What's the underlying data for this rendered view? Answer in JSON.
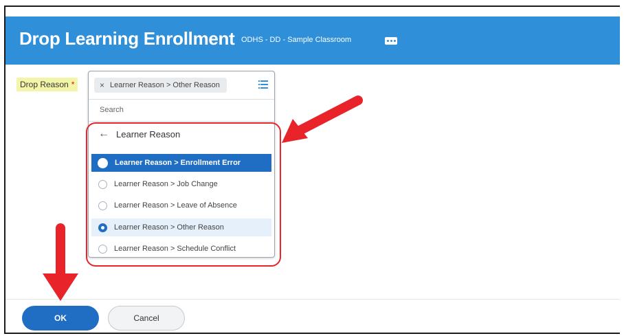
{
  "header": {
    "title": "Drop Learning Enrollment",
    "subtitle": "ODHS - DD - Sample Classroom"
  },
  "form": {
    "drop_reason_label": "Drop Reason",
    "required_marker": "*",
    "selected_value": "Learner Reason > Other Reason",
    "remove_glyph": "×"
  },
  "dropdown": {
    "search_placeholder": "Search",
    "back_label": "Learner Reason",
    "back_glyph": "←",
    "options": [
      {
        "label": "Learner Reason > Enrollment Error",
        "state": "highlighted"
      },
      {
        "label": "Learner Reason > Job Change",
        "state": "unchecked"
      },
      {
        "label": "Learner Reason > Leave of Absence",
        "state": "unchecked"
      },
      {
        "label": "Learner Reason > Other Reason",
        "state": "checked"
      },
      {
        "label": "Learner Reason > Schedule Conflict",
        "state": "unchecked"
      }
    ]
  },
  "footer": {
    "ok_label": "OK",
    "cancel_label": "Cancel"
  },
  "colors": {
    "header_blue": "#2f90d9",
    "primary_blue": "#1f6ec4",
    "annotation_red": "#e8232a",
    "label_highlight": "#f3f5a8"
  },
  "icons": [
    "more-icon",
    "remove-icon",
    "list-icon",
    "back-arrow-icon",
    "radio-icon",
    "annotation-arrow-icon"
  ]
}
